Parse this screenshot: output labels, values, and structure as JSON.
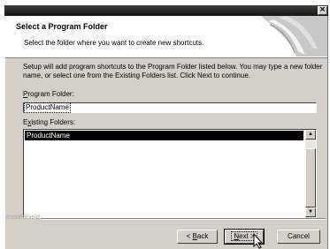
{
  "window": {
    "close_glyph": "×"
  },
  "header": {
    "title": "Select a Program Folder",
    "subtitle": "Select the folder where you want to create new shortcuts."
  },
  "body": {
    "setup_text": "Setup will add program shortcuts to the Program Folder listed below. You may type a new folder name, or select one from the Existing Folders list.  Click Next to continue."
  },
  "program_folder": {
    "label_key": "P",
    "label_rest": "rogram Folder:",
    "value": "ProductName"
  },
  "existing_folders": {
    "label_first": "E",
    "label_key": "x",
    "label_rest": "isting Folders:",
    "items": [
      "ProductName"
    ]
  },
  "footer": {
    "brand": "InstallShield"
  },
  "buttons": {
    "back_prefix": "< ",
    "back_key": "B",
    "back_rest": "ack",
    "next_key": "N",
    "next_rest": "ext >",
    "cancel": "Cancel"
  },
  "colors": {
    "dialog_bg": "#d4d0c8",
    "selection_bg": "#000000",
    "titlebar": "#151515"
  }
}
